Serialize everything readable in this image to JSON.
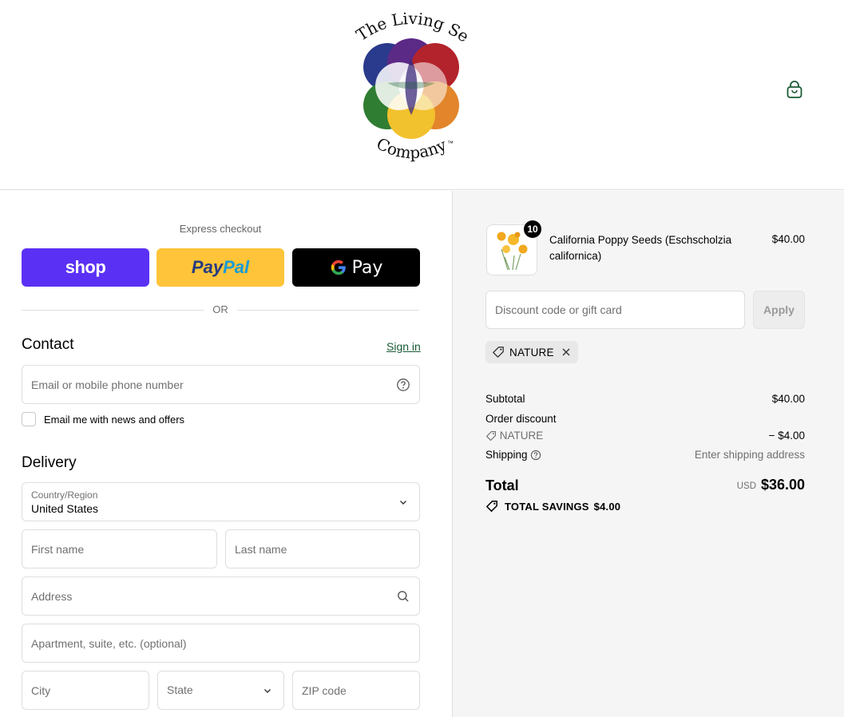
{
  "brand": {
    "logo_line1": "The Living Seed",
    "logo_line2": "Company",
    "logo_tm": "™",
    "colors": {
      "accent": "#1a5b34",
      "shop_pay": "#5a31f4",
      "paypal": "#ffc439",
      "gpay": "#000000"
    }
  },
  "header": {
    "cart_icon": "shopping-bag-icon"
  },
  "express": {
    "label": "Express checkout",
    "shop_label": "shop",
    "paypal_part1": "Pay",
    "paypal_part2": "Pal",
    "gpay_label": "Pay",
    "or_label": "OR"
  },
  "contact": {
    "title": "Contact",
    "sign_in": "Sign in",
    "email_placeholder": "Email or mobile phone number",
    "help_icon": "question-circle-icon",
    "newsletter_label": "Email me with news and offers",
    "newsletter_checked": false
  },
  "delivery": {
    "title": "Delivery",
    "country_label": "Country/Region",
    "country_value": "United States",
    "first_name_placeholder": "First name",
    "last_name_placeholder": "Last name",
    "address_placeholder": "Address",
    "apartment_placeholder": "Apartment, suite, etc. (optional)",
    "city_placeholder": "City",
    "state_label": "State",
    "zip_placeholder": "ZIP code"
  },
  "order": {
    "item": {
      "name": "California Poppy Seeds (Eschscholzia californica)",
      "quantity": "10",
      "price": "$40.00"
    },
    "discount_placeholder": "Discount code or gift card",
    "apply_label": "Apply",
    "applied_code": "NATURE",
    "summary": {
      "subtotal_label": "Subtotal",
      "subtotal_value": "$40.00",
      "order_discount_label": "Order discount",
      "discount_code": "NATURE",
      "discount_value": "− $4.00",
      "shipping_label": "Shipping",
      "shipping_value": "Enter shipping address",
      "total_label": "Total",
      "currency": "USD",
      "total_value": "$36.00",
      "savings_label": "TOTAL SAVINGS",
      "savings_value": "$4.00"
    }
  }
}
